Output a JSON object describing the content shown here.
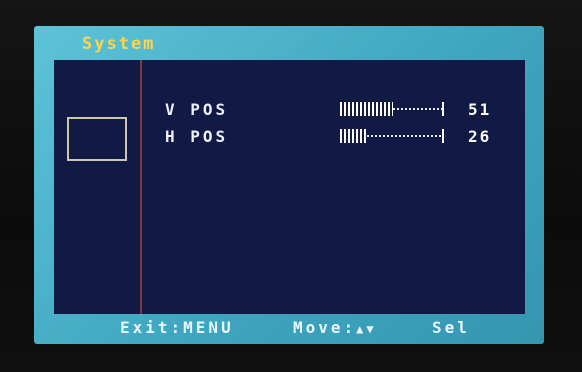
{
  "osd": {
    "title": "System",
    "rows": [
      {
        "label": "V POS",
        "value": "51",
        "level_percent": 51
      },
      {
        "label": "H POS",
        "value": "26",
        "level_percent": 26
      }
    ],
    "footer": {
      "exit": "Exit:MENU",
      "move": "Move:",
      "move_icons": "▲▼",
      "select": "Sel"
    },
    "colors": {
      "frame": "#49b3cc",
      "panel": "#101a45",
      "title": "#ffd44a",
      "text": "#eef0ff"
    }
  }
}
